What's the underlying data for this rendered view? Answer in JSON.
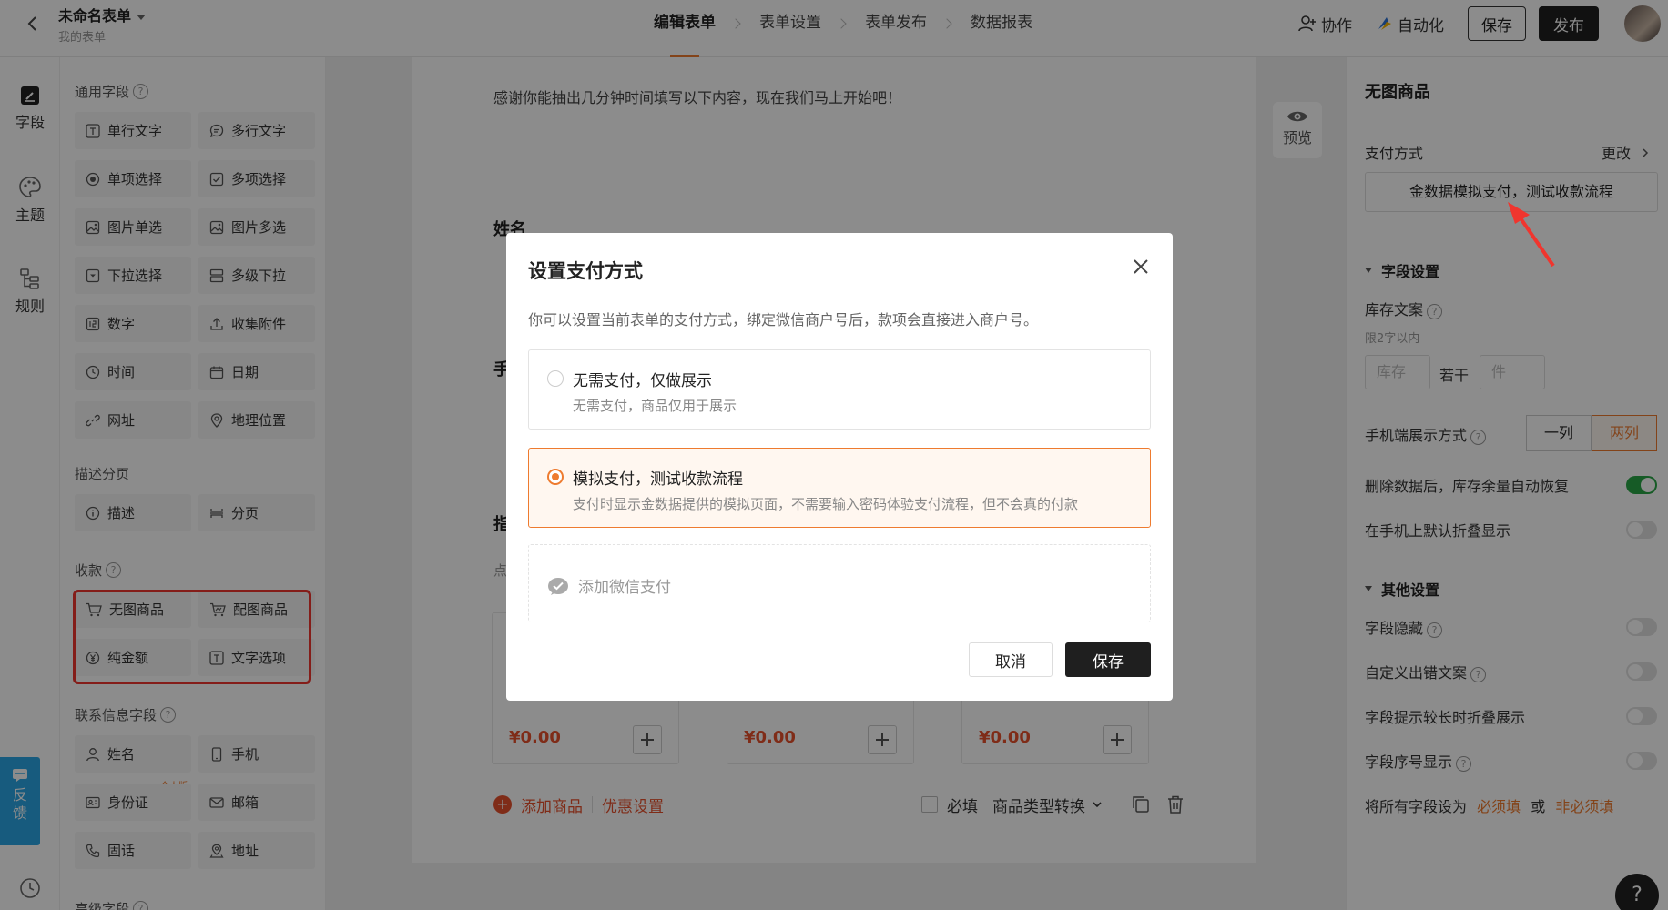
{
  "topbar": {
    "form_title": "未命名表单",
    "form_subtitle": "我的表单",
    "steps": [
      "编辑表单",
      "表单设置",
      "表单发布",
      "数据报表"
    ],
    "collaborate": "协作",
    "automate": "自动化",
    "save": "保存",
    "publish": "发布"
  },
  "leftnav": {
    "fields": "字段",
    "theme": "主题",
    "rules": "规则"
  },
  "palette": {
    "common_title": "通用字段",
    "common": [
      "单行文字",
      "多行文字",
      "单项选择",
      "多项选择",
      "图片单选",
      "图片多选",
      "下拉选择",
      "多级下拉",
      "数字",
      "收集附件",
      "时间",
      "日期",
      "网址",
      "地理位置"
    ],
    "desc_title": "描述分页",
    "desc": [
      "描述",
      "分页"
    ],
    "pay_title": "收款",
    "pay": [
      "无图商品",
      "配图商品",
      "纯金额",
      "文字选项"
    ],
    "contact_title": "联系信息字段",
    "contact": [
      "姓名",
      "手机",
      "身份证",
      "邮箱",
      "固话",
      "地址"
    ],
    "personal_tag": "个人版",
    "advanced_title": "高级字段",
    "feedback": "反馈"
  },
  "canvas": {
    "intro": "感谢你能抽出几分钟时间填写以下内容，现在我们马上开始吧！",
    "name_label": "姓名",
    "phone_label": "手",
    "goods_label": "指",
    "goods_hint": "点",
    "prices": [
      "¥0.00",
      "¥0.00",
      "¥0.00"
    ],
    "add_goods": "添加商品",
    "discount": "优惠设置",
    "required": "必填",
    "convert": "商品类型转换",
    "preview": "预览"
  },
  "rpanel": {
    "title": "无图商品",
    "pay_method_label": "支付方式",
    "change": "更改",
    "pay_method_value": "金数据模拟支付，测试收款流程",
    "field_settings": "字段设置",
    "stock_text": "库存文案",
    "stock_hint": "限2字以内",
    "stock_placeholder": "库存",
    "some": "若干",
    "unit_placeholder": "件",
    "mobile_display": "手机端展示方式",
    "one_col": "一列",
    "two_col": "两列",
    "restore_stock": "删除数据后，库存余量自动恢复",
    "fold_mobile": "在手机上默认折叠显示",
    "other_settings": "其他设置",
    "hide_field": "字段隐藏",
    "custom_error": "自定义出错文案",
    "fold_hint": "字段提示较长时折叠展示",
    "show_number": "字段序号显示",
    "set_all_prefix": "将所有字段设为",
    "required_link": "必须填",
    "or": "或",
    "optional_link": "非必须填"
  },
  "modal": {
    "title": "设置支付方式",
    "desc": "你可以设置当前表单的支付方式，绑定微信商户号后，款项会直接进入商户号。",
    "options": [
      {
        "title": "无需支付，仅做展示",
        "desc": "无需支付，商品仅用于展示"
      },
      {
        "title": "模拟支付，测试收款流程",
        "desc": "支付时显示金数据提供的模拟页面，不需要输入密码体验支付流程，但不会真的付款"
      }
    ],
    "wechat": "添加微信支付",
    "cancel": "取消",
    "save": "保存"
  },
  "help": "?",
  "colors": {
    "accent": "#ee7b2f",
    "price": "#e8502c",
    "annotation": "#f0352e",
    "feedback": "#2aa7e6",
    "switch_on": "#28a745"
  }
}
